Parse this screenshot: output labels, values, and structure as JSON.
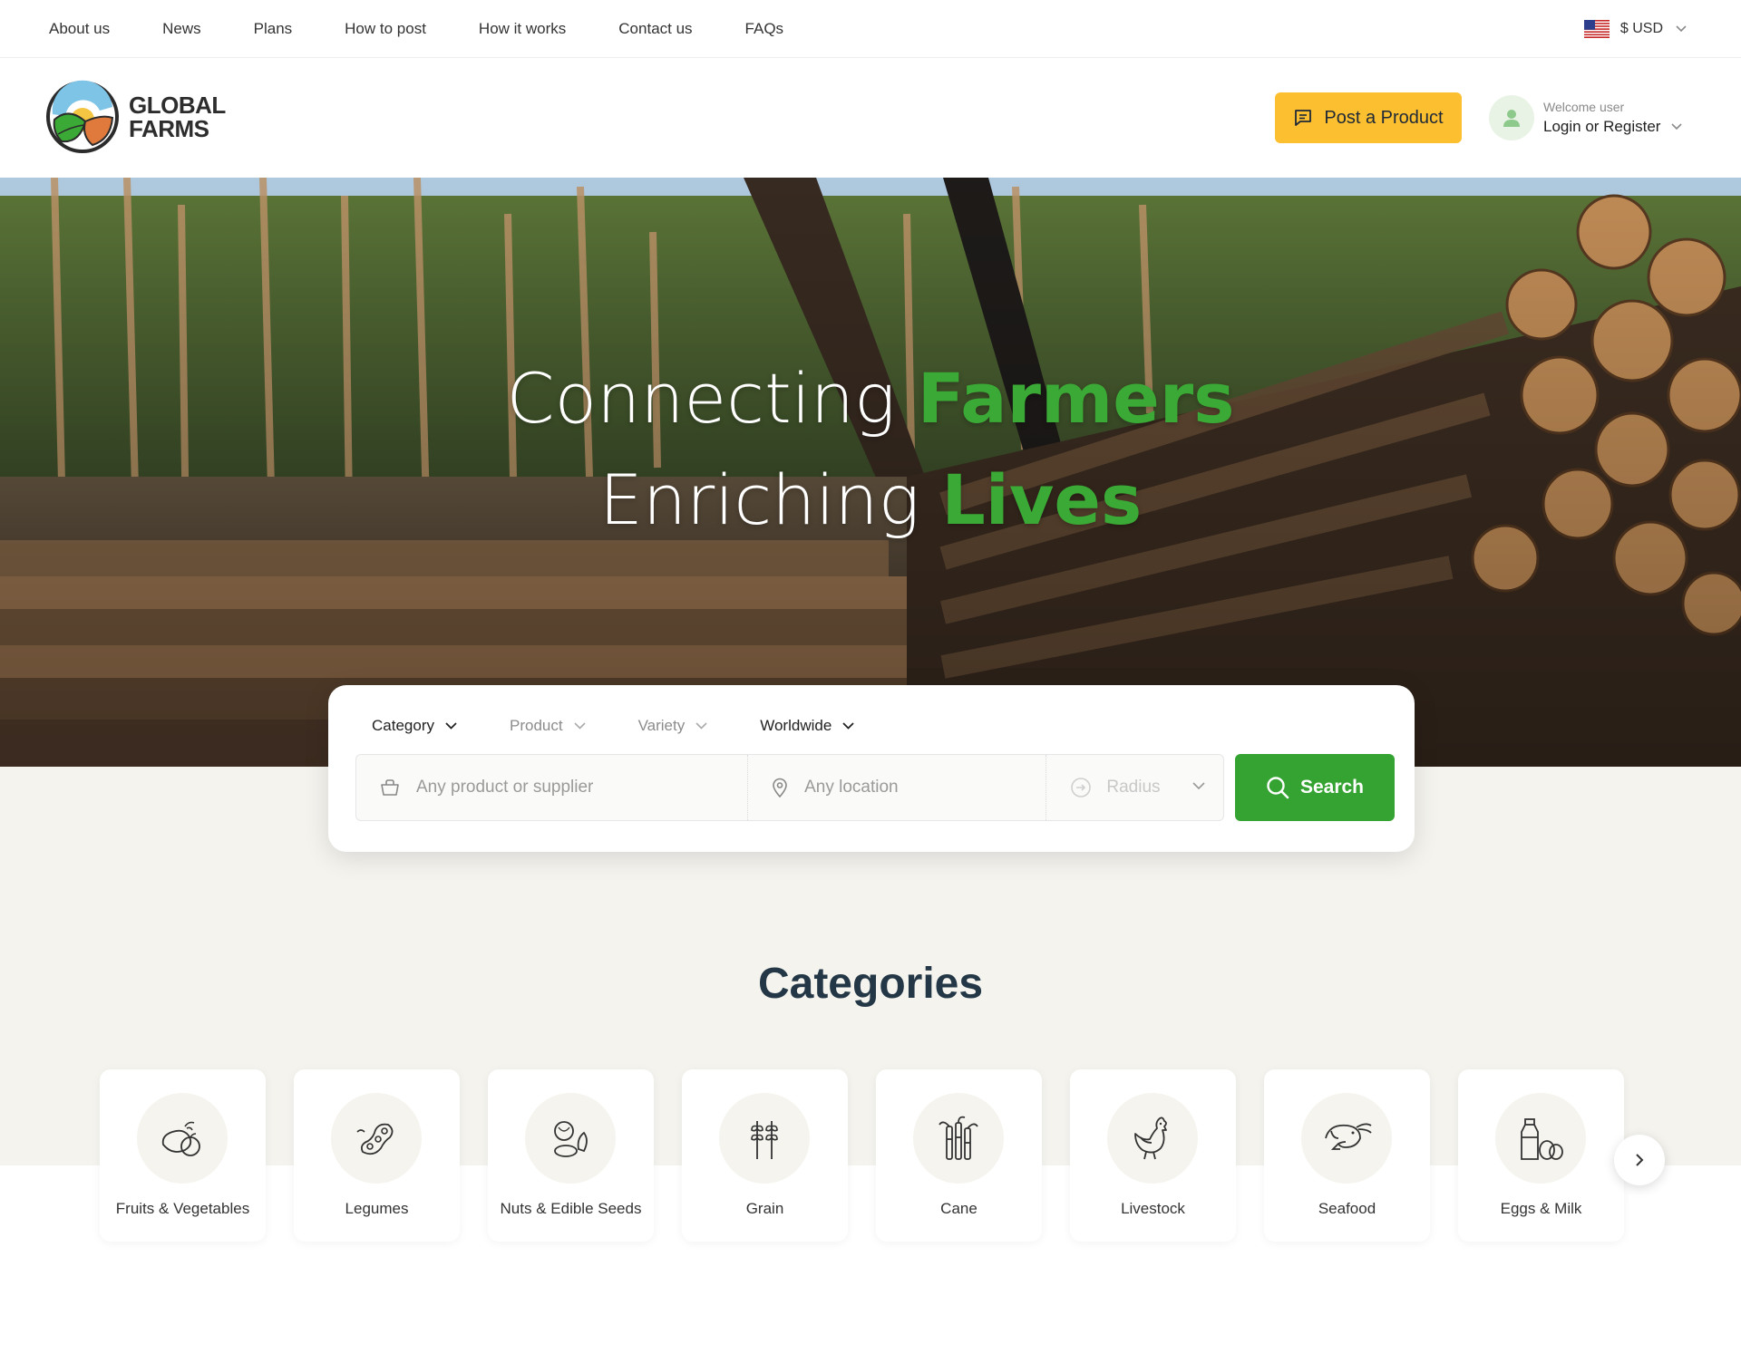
{
  "topnav": {
    "items": [
      "About us",
      "News",
      "Plans",
      "How to post",
      "How it works",
      "Contact us",
      "FAQs"
    ]
  },
  "currency": {
    "label": "$ USD",
    "flag_icon": "us-flag-icon"
  },
  "brand": {
    "line1": "GLOBAL",
    "line2": "FARMS"
  },
  "header": {
    "post_button": "Post a Product",
    "welcome": "Welcome user",
    "login": "Login or Register"
  },
  "hero": {
    "line1_plain": "Connecting ",
    "line1_accent": "Farmers",
    "line2_plain": "Enriching ",
    "line2_accent": "Lives"
  },
  "search": {
    "filters": [
      "Category",
      "Product",
      "Variety",
      "Worldwide"
    ],
    "product_placeholder": "Any product or supplier",
    "location_placeholder": "Any location",
    "radius_label": "Radius",
    "button": "Search"
  },
  "categories": {
    "title": "Categories",
    "items": [
      {
        "label": "Fruits & Vegetables",
        "icon": "fruits-vegetables-icon"
      },
      {
        "label": "Legumes",
        "icon": "legumes-icon"
      },
      {
        "label": "Nuts & Edible Seeds",
        "icon": "nuts-seeds-icon"
      },
      {
        "label": "Grain",
        "icon": "grain-icon"
      },
      {
        "label": "Cane",
        "icon": "cane-icon"
      },
      {
        "label": "Livestock",
        "icon": "livestock-icon"
      },
      {
        "label": "Seafood",
        "icon": "seafood-icon"
      },
      {
        "label": "Eggs & Milk",
        "icon": "eggs-milk-icon"
      }
    ]
  },
  "colors": {
    "accent_green": "#35a332",
    "post_yellow": "#fbbf2f",
    "heading_navy": "#233746"
  }
}
